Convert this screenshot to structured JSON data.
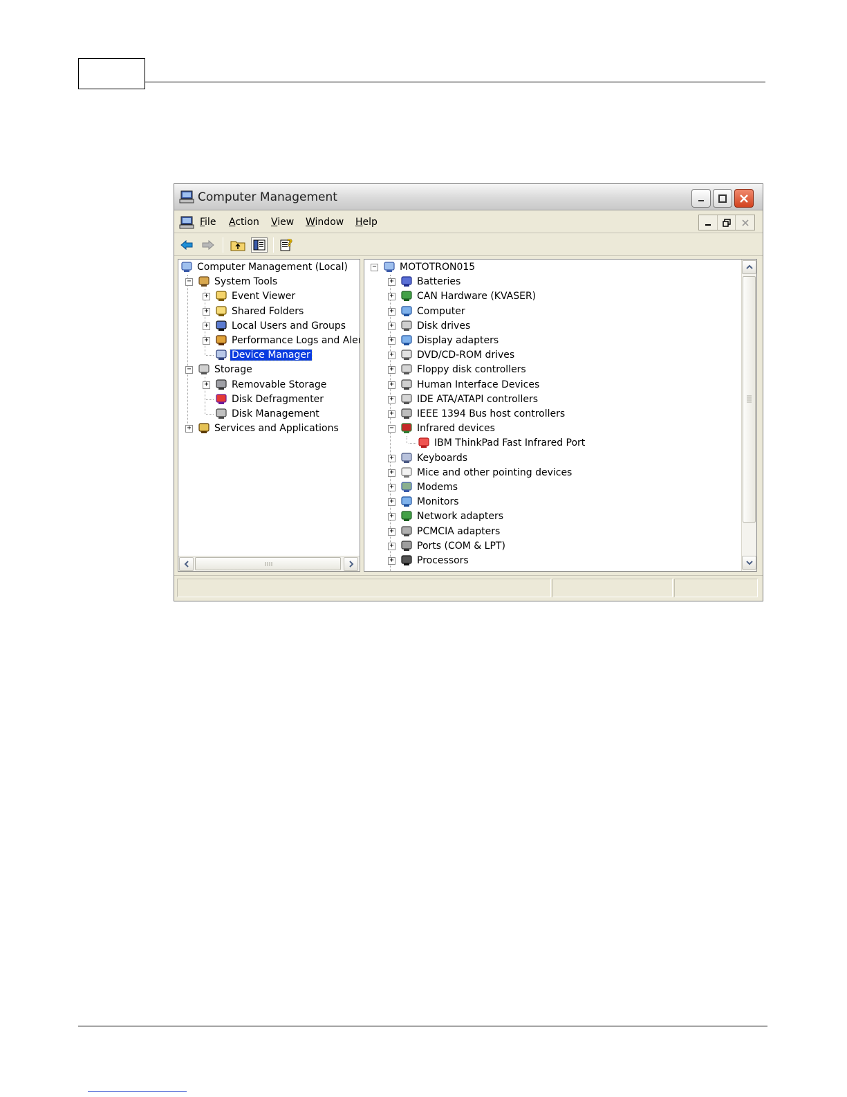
{
  "window": {
    "title": "Computer Management"
  },
  "menu": [
    {
      "accel": "F",
      "rest": "ile"
    },
    {
      "accel": "A",
      "rest": "ction"
    },
    {
      "accel": "V",
      "rest": "iew"
    },
    {
      "accel": "W",
      "rest": "indow"
    },
    {
      "accel": "H",
      "rest": "elp"
    }
  ],
  "left_tree": [
    {
      "label": "Computer Management (Local)",
      "icon": "computer-icon",
      "depth": 0,
      "expander": "none"
    },
    {
      "label": "System Tools",
      "icon": "tools-icon",
      "depth": 1,
      "expander": "minus"
    },
    {
      "label": "Event Viewer",
      "icon": "event-viewer-icon",
      "depth": 2,
      "expander": "plus"
    },
    {
      "label": "Shared Folders",
      "icon": "folder-icon",
      "depth": 2,
      "expander": "plus"
    },
    {
      "label": "Local Users and Groups",
      "icon": "users-icon",
      "depth": 2,
      "expander": "plus"
    },
    {
      "label": "Performance Logs and Alerts",
      "icon": "performance-icon",
      "depth": 2,
      "expander": "plus"
    },
    {
      "label": "Device Manager",
      "icon": "device-manager-icon",
      "depth": 2,
      "expander": "none",
      "selected": true
    },
    {
      "label": "Storage",
      "icon": "storage-icon",
      "depth": 1,
      "expander": "minus"
    },
    {
      "label": "Removable Storage",
      "icon": "removable-storage-icon",
      "depth": 2,
      "expander": "plus"
    },
    {
      "label": "Disk Defragmenter",
      "icon": "defragmenter-icon",
      "depth": 2,
      "expander": "none"
    },
    {
      "label": "Disk Management",
      "icon": "disk-management-icon",
      "depth": 2,
      "expander": "none"
    },
    {
      "label": "Services and Applications",
      "icon": "services-icon",
      "depth": 1,
      "expander": "plus"
    }
  ],
  "right_tree": [
    {
      "label": "MOTOTRON015",
      "icon": "computer-icon",
      "depth": 0,
      "expander": "minus"
    },
    {
      "label": "Batteries",
      "icon": "battery-icon",
      "depth": 1,
      "expander": "plus"
    },
    {
      "label": "CAN Hardware (KVASER)",
      "icon": "circuit-board-icon",
      "depth": 1,
      "expander": "plus"
    },
    {
      "label": "Computer",
      "icon": "monitor-icon",
      "depth": 1,
      "expander": "plus"
    },
    {
      "label": "Disk drives",
      "icon": "disk-drive-icon",
      "depth": 1,
      "expander": "plus"
    },
    {
      "label": "Display adapters",
      "icon": "display-adapter-icon",
      "depth": 1,
      "expander": "plus"
    },
    {
      "label": "DVD/CD-ROM drives",
      "icon": "cd-rom-icon",
      "depth": 1,
      "expander": "plus"
    },
    {
      "label": "Floppy disk controllers",
      "icon": "controller-icon",
      "depth": 1,
      "expander": "plus"
    },
    {
      "label": "Human Interface Devices",
      "icon": "hid-icon",
      "depth": 1,
      "expander": "plus"
    },
    {
      "label": "IDE ATA/ATAPI controllers",
      "icon": "controller-icon",
      "depth": 1,
      "expander": "plus"
    },
    {
      "label": "IEEE 1394 Bus host controllers",
      "icon": "ieee1394-icon",
      "depth": 1,
      "expander": "plus"
    },
    {
      "label": "Infrared devices",
      "icon": "infrared-icon",
      "depth": 1,
      "expander": "minus"
    },
    {
      "label": "IBM ThinkPad Fast Infrared Port",
      "icon": "infrared-port-icon",
      "depth": 2,
      "expander": "none"
    },
    {
      "label": "Keyboards",
      "icon": "keyboard-icon",
      "depth": 1,
      "expander": "plus"
    },
    {
      "label": "Mice and other pointing devices",
      "icon": "mouse-icon",
      "depth": 1,
      "expander": "plus"
    },
    {
      "label": "Modems",
      "icon": "modem-icon",
      "depth": 1,
      "expander": "plus"
    },
    {
      "label": "Monitors",
      "icon": "monitor-icon",
      "depth": 1,
      "expander": "plus"
    },
    {
      "label": "Network adapters",
      "icon": "circuit-board-icon",
      "depth": 1,
      "expander": "plus"
    },
    {
      "label": "PCMCIA adapters",
      "icon": "pcmcia-icon",
      "depth": 1,
      "expander": "plus"
    },
    {
      "label": "Ports (COM & LPT)",
      "icon": "port-icon",
      "depth": 1,
      "expander": "plus"
    },
    {
      "label": "Processors",
      "icon": "processor-icon",
      "depth": 1,
      "expander": "plus"
    }
  ],
  "toolbar": [
    "back-arrow-icon",
    "forward-arrow-icon",
    "up-folder-icon",
    "show-hide-tree-icon",
    "help-icon"
  ],
  "colors": {
    "selection": "#0a3be0",
    "window_face": "#ece9d8",
    "close_button": "#d2421f"
  }
}
